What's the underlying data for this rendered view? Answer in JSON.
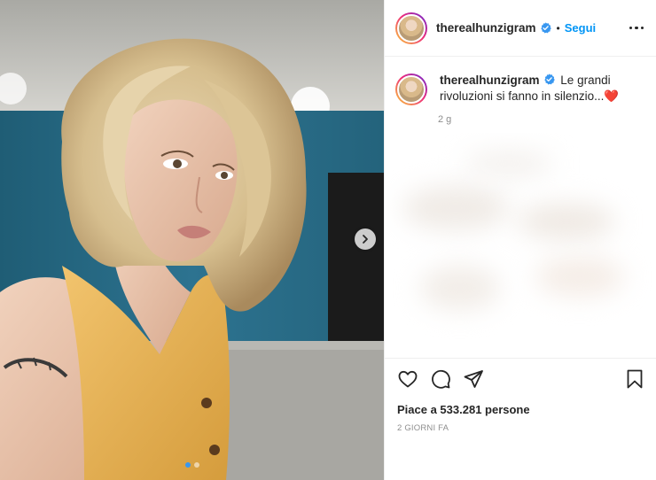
{
  "post": {
    "username": "therealhunzigram",
    "separator": "•",
    "follow_label": "Segui",
    "caption_text": "Le grandi rivoluzioni si fanno in silenzio...",
    "caption_emoji": "❤️",
    "time_ago": "2 g",
    "likes_text": "Piace a 533.281 persone",
    "date_text": "2 GIORNI FA",
    "carousel": {
      "total_slides": 2,
      "active_slide": 1
    }
  },
  "icons": {
    "verified": "verified-badge-icon",
    "more": "more-options-icon",
    "like": "heart-icon",
    "comment": "comment-icon",
    "share": "send-icon",
    "save": "bookmark-icon",
    "next": "chevron-right-icon"
  },
  "colors": {
    "follow_blue": "#0095f6",
    "verified_blue": "#3897f0",
    "text": "#262626",
    "muted": "#8e8e8e",
    "heart_red": "#e0213a"
  }
}
